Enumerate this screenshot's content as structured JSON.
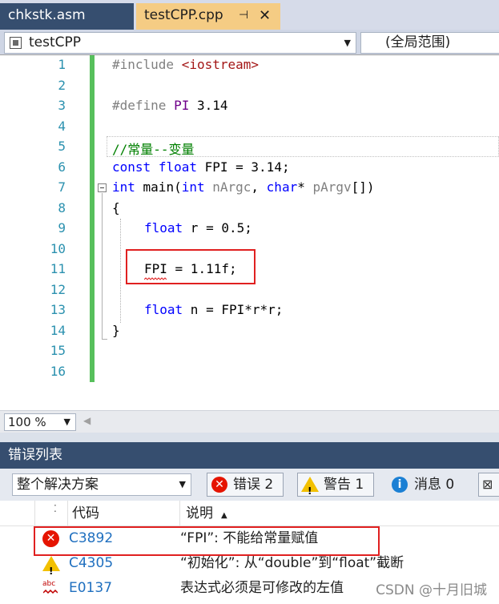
{
  "tabs": [
    {
      "label": "chkstk.asm",
      "active": false
    },
    {
      "label": "testCPP.cpp",
      "active": true
    }
  ],
  "tab_icons": {
    "pin": "pin-icon",
    "close": "close-icon"
  },
  "navbar": {
    "project": "testCPP",
    "scope": "(全局范围)"
  },
  "editor": {
    "line_numbers": [
      "1",
      "2",
      "3",
      "4",
      "5",
      "6",
      "7",
      "8",
      "9",
      "10",
      "11",
      "12",
      "13",
      "14",
      "15",
      "16"
    ],
    "lines": {
      "l1_directive": "#include ",
      "l1_header": "<iostream>",
      "l3_directive": "#define ",
      "l3_macro": "PI",
      "l3_value": " 3.14",
      "l5_comment": "//常量--变量",
      "l6_kw1": "const",
      "l6_kw2": "float",
      "l6_rest": " FPI = 3.14;",
      "l7_kw1": "int",
      "l7_name": " main(",
      "l7_kw2": "int",
      "l7_p1": " nArgc",
      "l7_comma": ", ",
      "l7_kw3": "char",
      "l7_star": "* ",
      "l7_p2": "pArgv",
      "l7_end": "[])",
      "l8": "{",
      "l9_kw": "float",
      "l9_rest": " r = 0.5;",
      "l11_var": "FPI",
      "l11_rest": " = 1.11f;",
      "l13_kw": "float",
      "l13_rest": " n = FPI*r*r;",
      "l14": "}"
    },
    "colors": {
      "keyword": "#0000ff",
      "comment": "#008000",
      "macro": "#6f008a",
      "change_bar": "#57c05c",
      "highlight_box": "#e02020"
    }
  },
  "zoom": "100 %",
  "error_list": {
    "title": "错误列表",
    "scope": "整个解决方案",
    "filters": {
      "errors": "错误 2",
      "warnings": "警告 1",
      "messages": "消息 0"
    },
    "columns": {
      "code": "代码",
      "description": "说明"
    },
    "rows": [
      {
        "severity": "error",
        "code": "C3892",
        "description": "“FPI”: 不能给常量赋值"
      },
      {
        "severity": "warning",
        "code": "C4305",
        "description": "“初始化”: 从“double”到“float”截断"
      },
      {
        "severity": "intellisense",
        "code": "E0137",
        "description": "表达式必须是可修改的左值"
      }
    ]
  },
  "watermark": "CSDN @十月旧城"
}
